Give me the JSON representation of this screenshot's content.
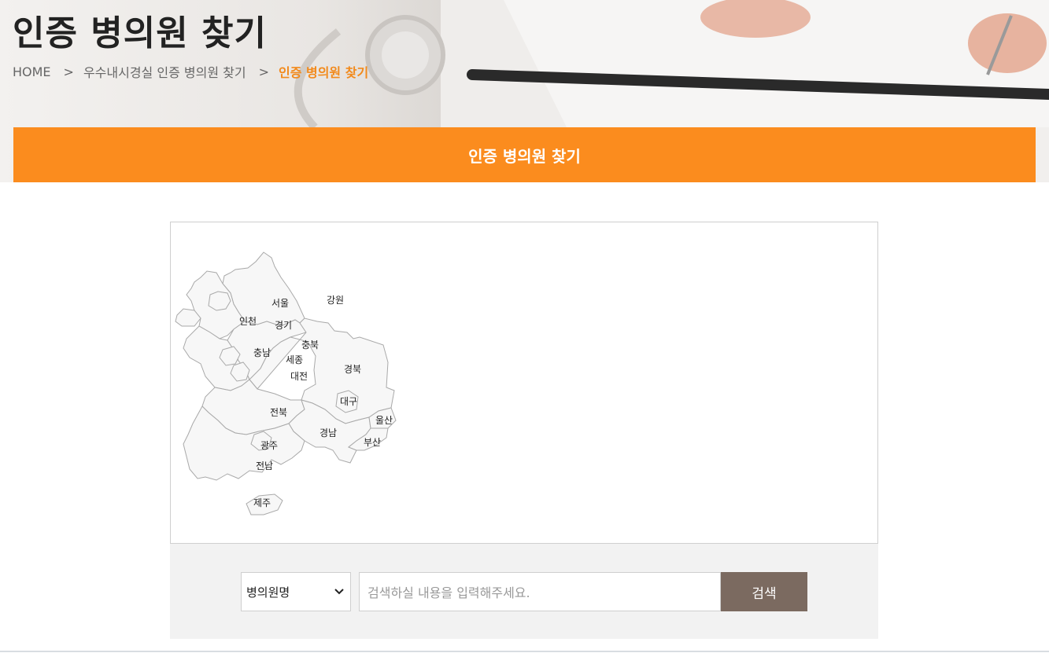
{
  "header": {
    "title": "인증 병의원 찾기",
    "breadcrumb": [
      {
        "label": "HOME"
      },
      {
        "label": "우수내시경실 인증 병의원 찾기"
      },
      {
        "label": "인증 병의원 찾기"
      }
    ],
    "breadcrumb_separator": ">"
  },
  "tab": {
    "label": "인증 병의원 찾기"
  },
  "map": {
    "regions": {
      "seoul": "서울",
      "gangwon": "강원",
      "incheon": "인천",
      "gyeonggi": "경기",
      "chungbuk": "충북",
      "chungnam": "충남",
      "sejong": "세종",
      "daejeon": "대전",
      "gyeongbuk": "경북",
      "daegu": "대구",
      "jeonbuk": "전북",
      "ulsan": "울산",
      "gyeongnam": "경남",
      "busan": "부산",
      "gwangju": "광주",
      "jeonnam": "전남",
      "jeju": "제주"
    }
  },
  "search": {
    "select_value": "병의원명",
    "placeholder": "검색하실 내용을 입력해주세요.",
    "button_label": "검색"
  },
  "colors": {
    "accent": "#fb8c1e",
    "button": "#7b6a60",
    "breadcrumb_current": "#f28a1c"
  }
}
